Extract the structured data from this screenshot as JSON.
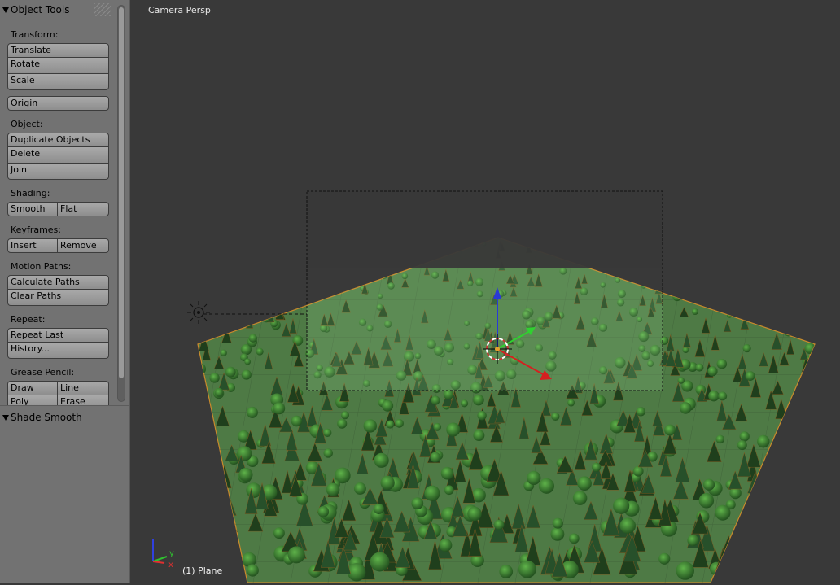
{
  "toolshelf": {
    "object_tools_title": "Object Tools",
    "transform_label": "Transform:",
    "translate": "Translate",
    "rotate": "Rotate",
    "scale": "Scale",
    "origin": "Origin",
    "object_label": "Object:",
    "duplicate_objects": "Duplicate Objects",
    "delete": "Delete",
    "join": "Join",
    "shading_label": "Shading:",
    "smooth": "Smooth",
    "flat": "Flat",
    "keyframes_label": "Keyframes:",
    "insert": "Insert",
    "remove": "Remove",
    "motion_paths_label": "Motion Paths:",
    "calculate_paths": "Calculate Paths",
    "clear_paths": "Clear Paths",
    "repeat_label": "Repeat:",
    "repeat_last": "Repeat Last",
    "history": "History...",
    "grease_pencil_label": "Grease Pencil:",
    "draw": "Draw",
    "line": "Line",
    "poly": "Poly",
    "erase": "Erase",
    "shade_smooth_title": "Shade Smooth"
  },
  "viewport": {
    "view_name": "Camera Persp",
    "object_name": "(1) Plane",
    "axis_y": "y",
    "axis_x": "x"
  },
  "colors": {
    "panel_bg": "#727272",
    "viewport_bg": "#393939",
    "terrain": "#4e7a45",
    "camera_bg": "#383838"
  },
  "icons": [
    "collapse-triangle-icon",
    "panel-grip-icon",
    "lamp-icon",
    "3d-cursor-icon",
    "axis-gizmo-icon",
    "transform-manipulator-icon"
  ]
}
